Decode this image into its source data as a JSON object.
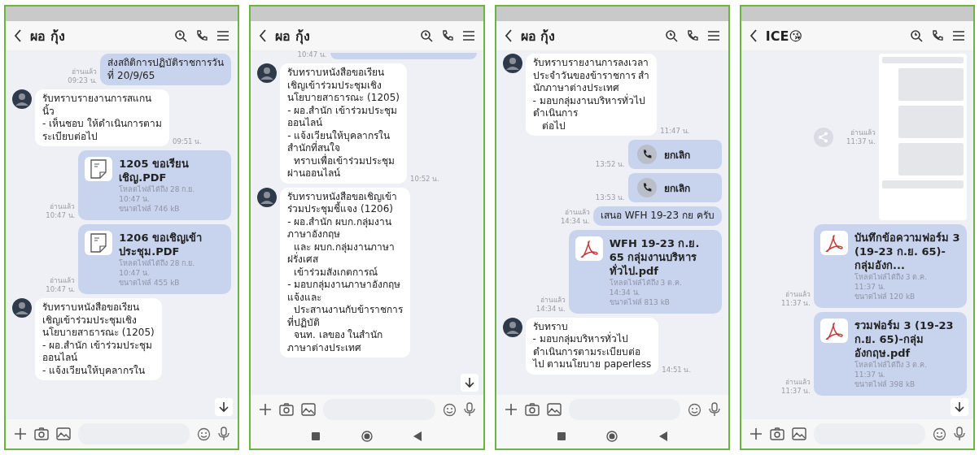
{
  "phones": [
    {
      "title": "ผอ กุ้ง",
      "nav_bar": false,
      "scroll_button": true,
      "messages": [
        {
          "kind": "text-out",
          "text": "ส่งสถิติการปฏิบัติราชการวัน\nที่ 20/9/65",
          "read": "อ่านแล้ว",
          "time": "09:23 น."
        },
        {
          "kind": "text-in",
          "text": "รับทราบรายงานการสแกน\nนิ้ว\n- เห็นชอบ ให้ดำเนินการตาม\nระเบียบต่อไป",
          "time": "09:51 น."
        },
        {
          "kind": "file-doc",
          "name": "1205 ขอเรียนเชิญ.PDF",
          "expiry": "โหลดไฟล์ได้ถึง 28 ก.ย.",
          "expiry_time": "10:47 น.",
          "size": "ขนาดไฟล์ 746 kB",
          "read": "อ่านแล้ว",
          "time": "10:47 น."
        },
        {
          "kind": "file-doc",
          "name": "1206 ขอเชิญเข้าประชุม.PDF",
          "expiry": "โหลดไฟล์ได้ถึง 28 ก.ย.",
          "expiry_time": "10:47 น.",
          "size": "ขนาดไฟล์ 455 kB",
          "read": "อ่านแล้ว",
          "time": "10:47 น."
        },
        {
          "kind": "text-in",
          "text": "รับทราบหนังสือขอเรียน\nเชิญเข้าร่วมประชุมเชิง\nนโยบายสาธารณะ (1205)\n- ผอ.สำนัก เข้าร่วมประชุม\nออนไลน์\n- แจ้งเวียนให้บุคลากรใน"
        }
      ]
    },
    {
      "title": "ผอ กุ้ง",
      "nav_bar": true,
      "scroll_button": true,
      "messages": [
        {
          "kind": "stub",
          "time": "10:47 น."
        },
        {
          "kind": "text-in",
          "text": "รับทราบหนังสือขอเรียน\nเชิญเข้าร่วมประชุมเชิง\nนโยบายสาธารณะ (1205)\n- ผอ.สำนัก เข้าร่วมประชุม\nออนไลน์\n- แจ้งเวียนให้บุคลากรใน\nสำนักที่สนใจ\n  ทราบเพื่อเข้าร่วมประชุม\nผ่านออนไลน์",
          "time": "10:52 น."
        },
        {
          "kind": "text-in",
          "text": "รับทราบหนังสือขอเชิญเข้า\nร่วมประชุมชี้แจง (1206)\n- ผอ.สำนัก ผบก.กลุ่มงาน\nภาษาอังกฤษ\n  และ ผบก.กลุ่มงานภาษา\nฝรั่งเศส\n  เข้าร่วมสังเกตการณ์\n- มอบกลุ่มงานภาษาอังกฤษ\nแจ้งและ\n  ประสานงานกับข้าราชการ\nที่ปฏิบัติ\n  จนท. เลของ ในสำนัก\nภาษาต่างประเทศ"
        }
      ]
    },
    {
      "title": "ผอ กุ้ง",
      "nav_bar": true,
      "scroll_button": false,
      "messages": [
        {
          "kind": "text-in",
          "text": "รับทราบรายงานการลงเวลา\nประจำวันของข้าราชการ สำ\nนักภาษาต่างประเทศ\n- มอบกลุ่มงานบริหารทั่วไป\nดำเนินการ\n   ต่อไป",
          "time": "11:47 น."
        },
        {
          "kind": "call",
          "label": "ยกเลิก",
          "time": "13:52 น."
        },
        {
          "kind": "call",
          "label": "ยกเลิก",
          "time": "13:53 น."
        },
        {
          "kind": "text-out",
          "text": "เสนอ WFH 19-23 กย ครับ",
          "read": "อ่านแล้ว",
          "time": "14:34 น."
        },
        {
          "kind": "file-pdf",
          "name": "WFH 19-23 ก.ย. 65 กลุ่มงานบริหารทั่วไป.pdf",
          "expiry": "โหลดไฟล์ได้ถึง 3 ต.ค.",
          "expiry_time": "14:34 น.",
          "size": "ขนาดไฟล์ 813 kB",
          "read": "อ่านแล้ว",
          "time": "14:34 น."
        },
        {
          "kind": "text-in",
          "text": "รับทราบ\n- มอบกลุ่มบริหารทั่วไป\nดำเนินการตามระเบียบต่อ\nไป ตามนโยบาย paperless",
          "time": "14:51 น."
        }
      ]
    },
    {
      "title": "ICE😘",
      "nav_bar": false,
      "scroll_button": true,
      "messages": [
        {
          "kind": "screenshot",
          "read": "อ่านแล้ว",
          "time": "11:37 น."
        },
        {
          "kind": "file-pdf",
          "name": "บันทึกข้อความฟอร์ม 3 (19-23 ก.ย. 65)-กลุ่มอังก...",
          "expiry": "โหลดไฟล์ได้ถึง 3 ต.ค.",
          "expiry_time": "11:37 น.",
          "size": "ขนาดไฟล์ 120 kB",
          "read": "อ่านแล้ว",
          "time": "11:37 น."
        },
        {
          "kind": "file-pdf",
          "name": "รวมฟอร์ม 3 (19-23 ก.ย. 65)-กลุ่มอังกฤษ.pdf",
          "expiry": "โหลดไฟล์ได้ถึง 3 ต.ค.",
          "expiry_time": "11:37 น.",
          "size": "ขนาดไฟล์ 398 kB",
          "read": "อ่านแล้ว",
          "time": "11:37 น."
        }
      ]
    }
  ]
}
